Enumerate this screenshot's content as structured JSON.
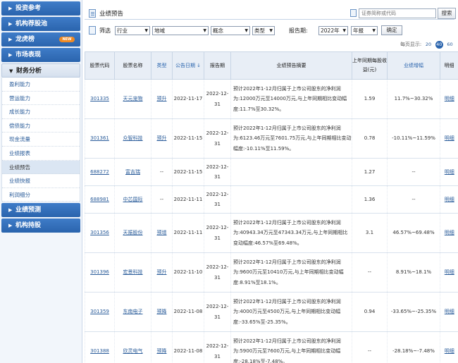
{
  "sidebar": {
    "items": [
      {
        "label": "投资参考",
        "open": false
      },
      {
        "label": "机构荐股池",
        "open": false
      },
      {
        "label": "龙虎榜",
        "open": false,
        "badge": "NEW"
      },
      {
        "label": "市场表现",
        "open": false
      },
      {
        "label": "财务分析",
        "open": true
      },
      {
        "label": "业绩预测",
        "open": false
      },
      {
        "label": "机构持股",
        "open": false
      }
    ],
    "sub_items": [
      "盈利能力",
      "营运能力",
      "成长能力",
      "偿债能力",
      "现金流量",
      "业绩报表",
      "业绩预告",
      "业绩快报",
      "利润细分"
    ],
    "active_sub": "业绩预告"
  },
  "header": {
    "title": "业绩预告",
    "search_placeholder": "证券简称或代码",
    "search_button": "搜索"
  },
  "filters": {
    "label": "筛选",
    "industry": "行业",
    "region": "地域",
    "concept": "概念",
    "type": "类型",
    "report_label": "报告期:",
    "year": "2022年",
    "period": "年报",
    "confirm": "确定"
  },
  "perpage": {
    "label": "每页显示:",
    "options": [
      "20",
      "40",
      "60"
    ],
    "active": "40"
  },
  "table": {
    "headers": [
      "股票代码",
      "股票名称",
      "类型",
      "公告日期 ↓",
      "报告期",
      "业绩预告摘要",
      "上年同期每股收益(元)",
      "业绩增幅",
      "明细"
    ],
    "rows": [
      {
        "code": "301335",
        "name": "天元宠物",
        "type": "预升",
        "date": "2022-11-17",
        "period": "2022-12-31",
        "summary": "预计2022年1-12月归属于上市公司股东的净利润为:12000万元至14000万元,与上年同期相比变动幅度:11.7%至30.32%。",
        "eps": "1.59",
        "growth": "11.7%~30.32%",
        "detail": "明细"
      },
      {
        "code": "301361",
        "name": "众智科技",
        "type": "预升",
        "date": "2022-11-15",
        "period": "2022-12-31",
        "summary": "预计2022年1-12月归属于上市公司股东的净利润为:6123.46万元至7601.75万元,与上年同期相比变动幅度:-10.11%至11.59%。",
        "eps": "0.78",
        "growth": "-10.11%~11.59%",
        "detail": "明细"
      },
      {
        "code": "688272",
        "name": "富吉瑞",
        "type": "--",
        "date": "2022-11-15",
        "period": "2022-12-31",
        "summary": "",
        "eps": "1.27",
        "growth": "--",
        "detail": "明细"
      },
      {
        "code": "688981",
        "name": "中芯国际",
        "type": "--",
        "date": "2022-11-11",
        "period": "2022-12-31",
        "summary": "",
        "eps": "1.36",
        "growth": "--",
        "detail": "明细"
      },
      {
        "code": "301356",
        "name": "天振股份",
        "type": "预增",
        "date": "2022-11-11",
        "period": "2022-12-31",
        "summary": "预计2022年1-12月归属于上市公司股东的净利润为:40943.34万元至47343.34万元,与上年同期相比变动幅度:46.57%至69.48%。",
        "eps": "3.1",
        "growth": "46.57%~69.48%",
        "detail": "明细"
      },
      {
        "code": "301396",
        "name": "宏景科技",
        "type": "预升",
        "date": "2022-11-10",
        "period": "2022-12-31",
        "summary": "预计2022年1-12月归属于上市公司股东的净利润为:9600万元至10410万元,与上年同期相比变动幅度:8.91%至18.1%。",
        "eps": "--",
        "growth": "8.91%~18.1%",
        "detail": "明细"
      },
      {
        "code": "301359",
        "name": "东南电子",
        "type": "预降",
        "date": "2022-11-08",
        "period": "2022-12-31",
        "summary": "预计2022年1-12月归属于上市公司股东的净利润为:4000万元至4500万元,与上年同期相比变动幅度:-33.65%至-25.35%。",
        "eps": "0.94",
        "growth": "-33.65%~-25.35%",
        "detail": "明细"
      },
      {
        "code": "301388",
        "name": "欣灵电气",
        "type": "预降",
        "date": "2022-11-08",
        "period": "2022-12-31",
        "summary": "预计2022年1-12月归属于上市公司股东的净利润为:5900万元至7600万元,与上年同期相比变动幅度:-28.18%至-7.48%。",
        "eps": "--",
        "growth": "-28.18%~-7.48%",
        "detail": "明细"
      }
    ]
  },
  "colors": {
    "accent": "#2a64ad",
    "link": "#2a5c9a",
    "header_bg": "#e8eef6"
  }
}
